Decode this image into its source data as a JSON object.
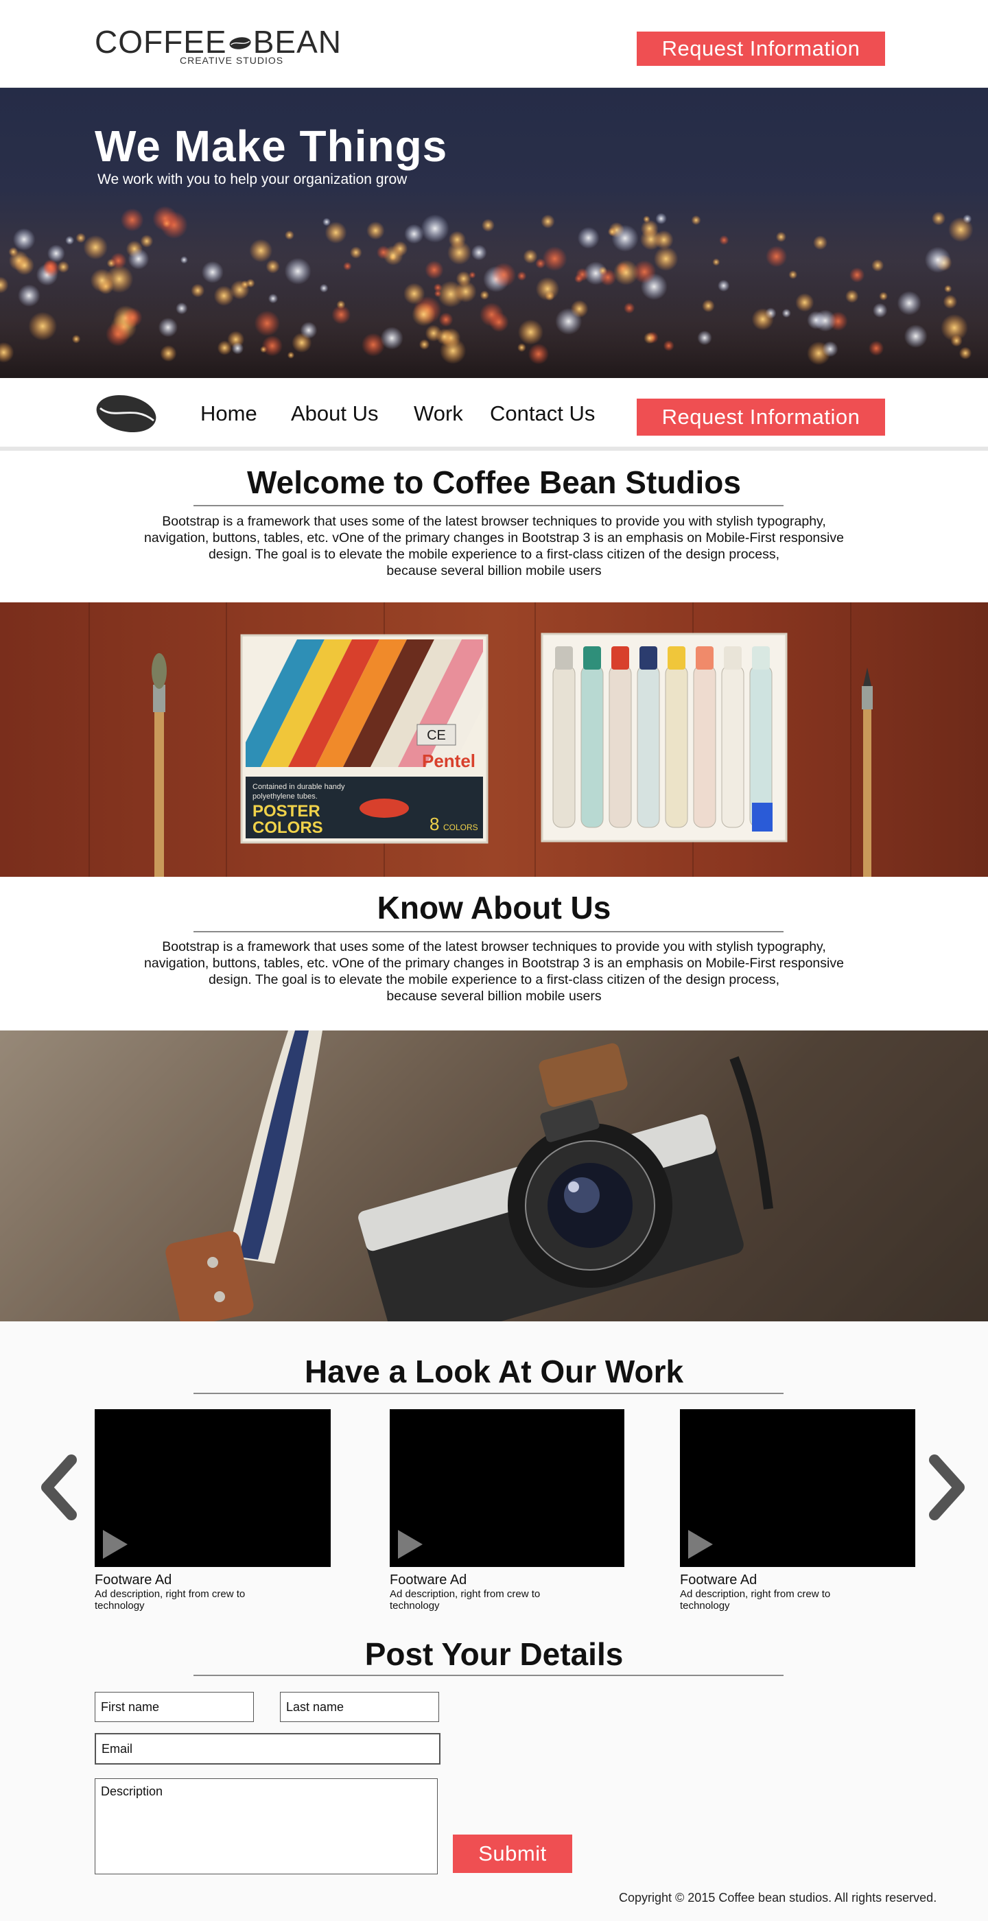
{
  "header": {
    "logo_left": "COFFEE",
    "logo_right": "BEAN",
    "logo_sub": "CREATIVE STUDIOS",
    "cta_label": "Request Information"
  },
  "hero": {
    "title": "We Make Things",
    "subtitle": "We work with you to help your organization grow"
  },
  "nav": {
    "items": [
      {
        "label": "Home"
      },
      {
        "label": "About Us"
      },
      {
        "label": "Work"
      },
      {
        "label": "Contact Us"
      }
    ],
    "cta_label": "Request Information"
  },
  "welcome": {
    "title": "Welcome to Coffee Bean Studios",
    "lines": [
      "Bootstrap is a framework that uses some of the latest browser techniques to provide you with stylish typography,",
      "navigation, buttons, tables, etc. vOne of the primary changes in Bootstrap 3 is an emphasis on Mobile-First responsive",
      "design. The goal is to elevate the mobile experience to a first-class citizen of the design process,",
      "because several billion mobile users"
    ]
  },
  "paint_photo": {
    "box_text_1": "Contained in durable handy",
    "box_text_2": "polyethylene tubes.",
    "brand": "Pentel",
    "product_1": "POSTER",
    "product_2": "COLORS",
    "count": "8",
    "count_unit": "COLORS",
    "mark": "CE"
  },
  "about": {
    "title": "Know About Us",
    "lines": [
      "Bootstrap is a framework that uses some of the latest browser techniques to provide you with stylish typography,",
      "navigation, buttons, tables, etc. vOne of the primary changes in Bootstrap 3 is an emphasis on Mobile-First responsive",
      "design. The goal is to elevate the mobile experience to a first-class citizen of the design process,",
      "because several billion mobile users"
    ]
  },
  "work": {
    "title": "Have a Look At Our Work",
    "cards": [
      {
        "title": "Footware Ad",
        "desc": "Ad description, right from crew to technology"
      },
      {
        "title": "Footware Ad",
        "desc": "Ad description, right from crew to technology"
      },
      {
        "title": "Footware Ad",
        "desc": "Ad description, right from crew to technology"
      }
    ]
  },
  "contact": {
    "title": "Post Your Details",
    "first_name_placeholder": "First name",
    "last_name_placeholder": "Last name",
    "email_placeholder": "Email",
    "description_placeholder": "Description",
    "submit_label": "Submit"
  },
  "footer": {
    "copyright": "Copyright © 2015 Coffee bean studios. All rights reserved."
  },
  "colors": {
    "accent": "#ef4f52",
    "text": "#111111",
    "rule": "#8a8a8a"
  }
}
